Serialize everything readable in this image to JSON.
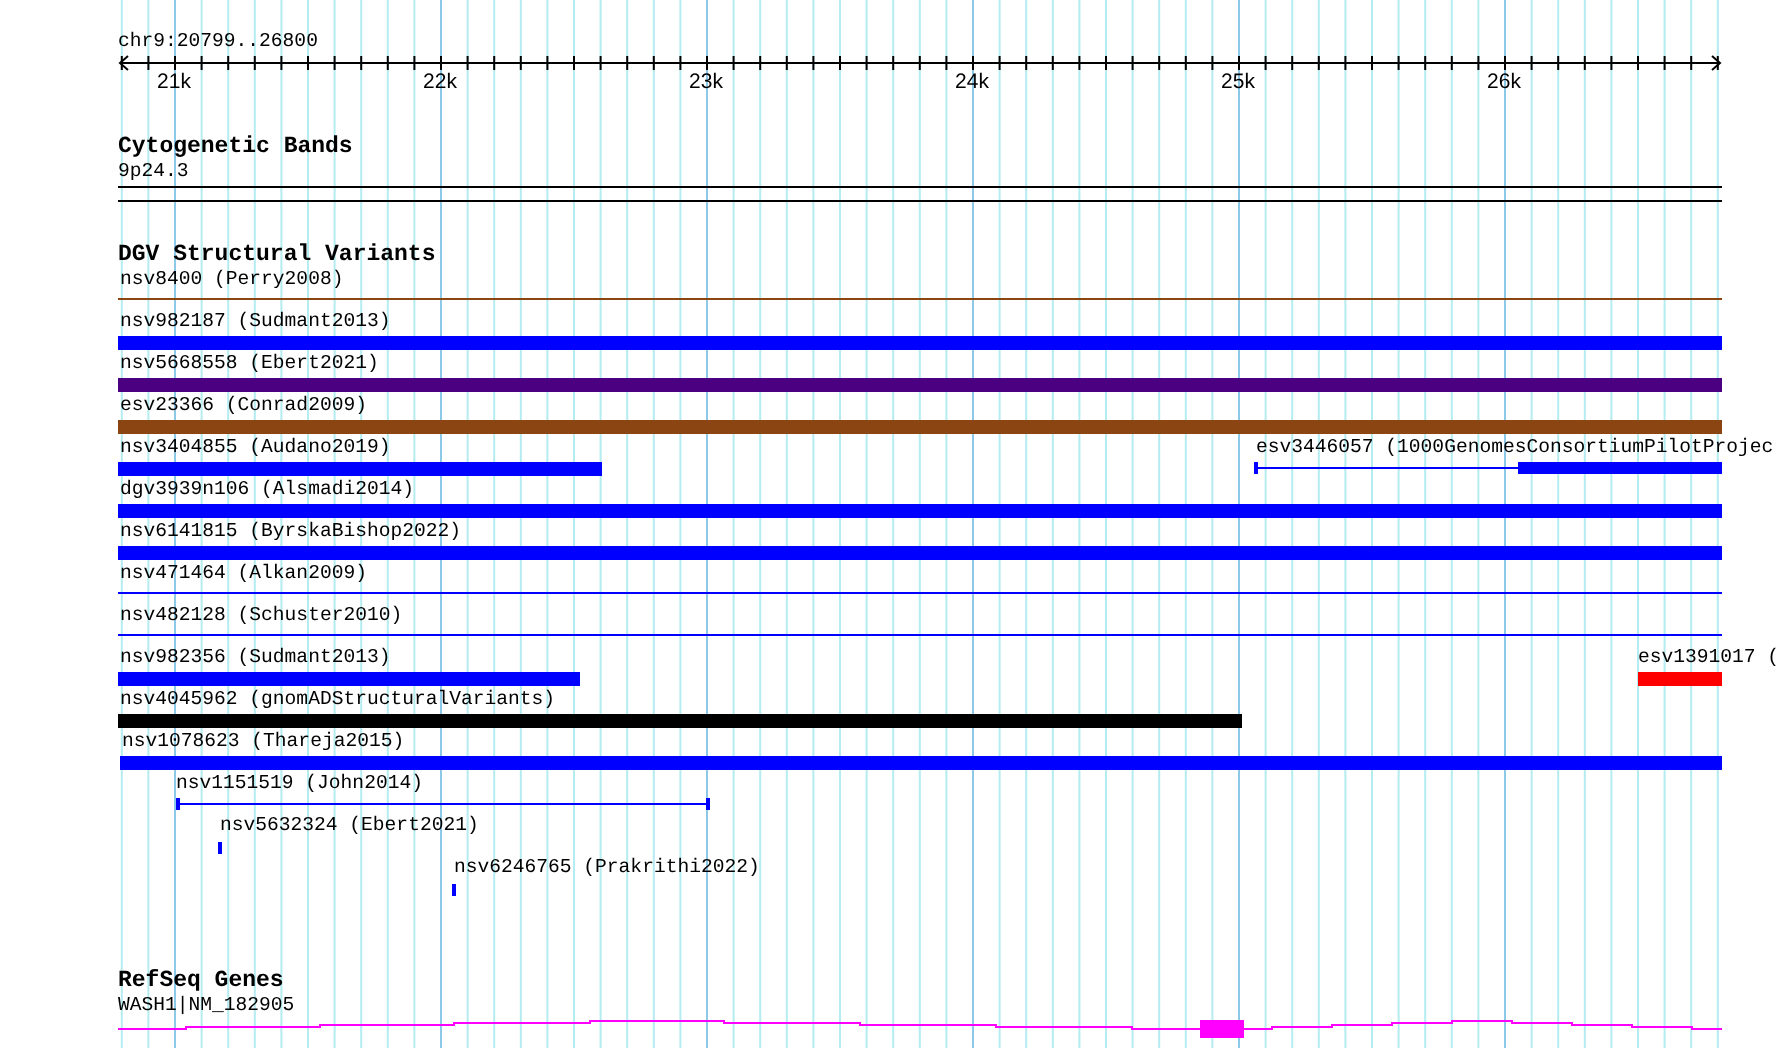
{
  "ruler": {
    "location": "chr9:20799..26800",
    "ticks": [
      "21k",
      "22k",
      "23k",
      "24k",
      "25k",
      "26k"
    ]
  },
  "tracks": [
    {
      "title": "Cytogenetic Bands",
      "kind": "bands",
      "features": [
        {
          "label": "9p24.3"
        }
      ]
    },
    {
      "title": "DGV Structural Variants",
      "kind": "variants",
      "lanes": [
        {
          "features": [
            {
              "label": "nsv8400 (Perry2008)",
              "kind": "line",
              "color": "#8b4513"
            }
          ]
        },
        {
          "features": [
            {
              "label": "nsv982187 (Sudmant2013)",
              "kind": "bar",
              "color": "#0000ff"
            }
          ]
        },
        {
          "features": [
            {
              "label": "nsv5668558 (Ebert2021)",
              "kind": "bar",
              "color": "#4b0082"
            }
          ]
        },
        {
          "features": [
            {
              "label": "esv23366 (Conrad2009)",
              "kind": "bar",
              "color": "#8b4513"
            }
          ]
        },
        {
          "features": [
            {
              "label": "nsv3404855 (Audano2019)",
              "kind": "bar",
              "color": "#0000ff"
            },
            {
              "label": "esv3446057 (1000GenomesConsortiumPilotProjec",
              "kind": "split",
              "color": "#0000ff"
            }
          ]
        },
        {
          "features": [
            {
              "label": "dgv3939n106 (Alsmadi2014)",
              "kind": "bar",
              "color": "#0000ff"
            }
          ]
        },
        {
          "features": [
            {
              "label": "nsv6141815 (ByrskaBishop2022)",
              "kind": "bar",
              "color": "#0000ff"
            }
          ]
        },
        {
          "features": [
            {
              "label": "nsv471464 (Alkan2009)",
              "kind": "line",
              "color": "#0000ff"
            }
          ]
        },
        {
          "features": [
            {
              "label": "nsv482128 (Schuster2010)",
              "kind": "line",
              "color": "#0000ff"
            }
          ]
        },
        {
          "features": [
            {
              "label": "nsv982356 (Sudmant2013)",
              "kind": "bar",
              "color": "#0000ff"
            },
            {
              "label": "esv1391017 (",
              "kind": "bar",
              "color": "#ff0000"
            }
          ]
        },
        {
          "features": [
            {
              "label": "nsv4045962 (gnomADStructuralVariants)",
              "kind": "bar",
              "color": "#000000"
            }
          ]
        },
        {
          "features": [
            {
              "label": "nsv1078623 (Thareja2015)",
              "kind": "bar",
              "color": "#0000ff"
            }
          ]
        },
        {
          "features": [
            {
              "label": "nsv1151519 (John2014)",
              "kind": "span",
              "color": "#0000ff"
            }
          ]
        },
        {
          "features": [
            {
              "label": "nsv5632324 (Ebert2021)",
              "kind": "tick",
              "color": "#0000ff"
            }
          ]
        },
        {
          "features": [
            {
              "label": "nsv6246765 (Prakrithi2022)",
              "kind": "tick",
              "color": "#0000ff"
            }
          ]
        }
      ]
    },
    {
      "title": "RefSeq Genes",
      "kind": "genes",
      "features": [
        {
          "label": "WASH1|NM_182905",
          "color": "#ff00ff"
        }
      ]
    }
  ]
}
